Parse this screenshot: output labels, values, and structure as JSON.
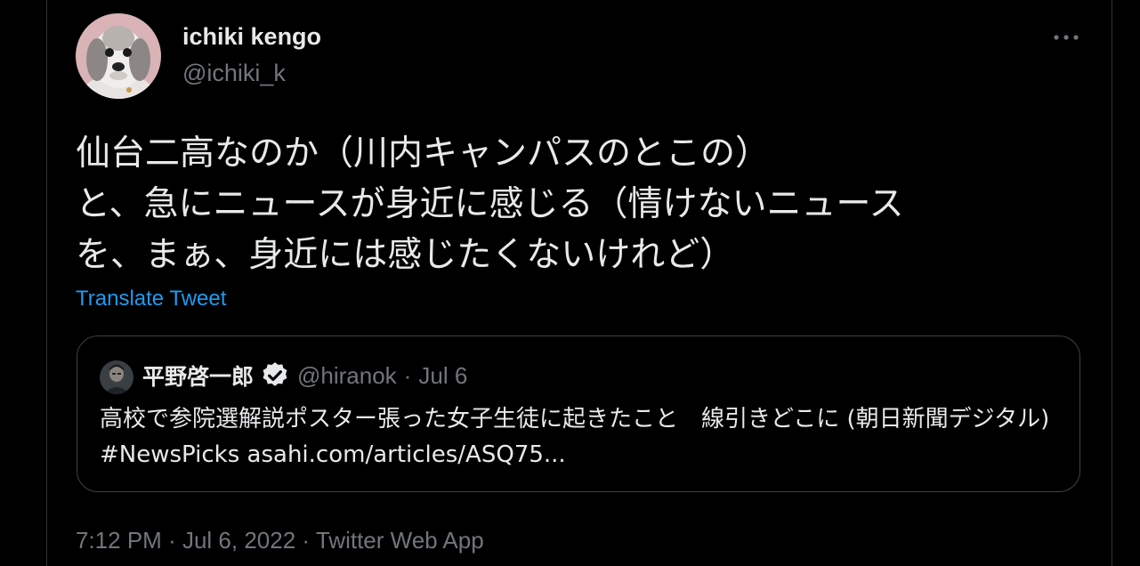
{
  "author": {
    "name": "ichiki kengo",
    "handle": "@ichiki_k",
    "avatar_icon": "dog-avatar-icon"
  },
  "more_icon": "more-horizontal-icon",
  "tweet": {
    "text": "仙台二高なのか（川内キャンパスのとこの）\nと、急にニュースが身近に感じる（情けないニュース\nを、まぁ、身近には感じたくないけれど）",
    "translate_label": "Translate Tweet"
  },
  "quoted_tweet": {
    "name": "平野啓一郎",
    "verified_icon": "verified-badge-icon",
    "handle": "@hiranok",
    "separator": "·",
    "date": "Jul 6",
    "text": "高校で参院選解説ポスター張った女子生徒に起きたこと　線引きどこに (朝日新聞デジタル) #NewsPicks asahi.com/articles/ASQ75..."
  },
  "meta": {
    "time": "7:12 PM",
    "separator1": "·",
    "date": "Jul 6, 2022",
    "separator2": "·",
    "source": "Twitter Web App"
  },
  "colors": {
    "background": "#000000",
    "text_primary": "#e7e9ea",
    "text_secondary": "#71767b",
    "link": "#1d9bf0",
    "border": "#2f3336"
  }
}
